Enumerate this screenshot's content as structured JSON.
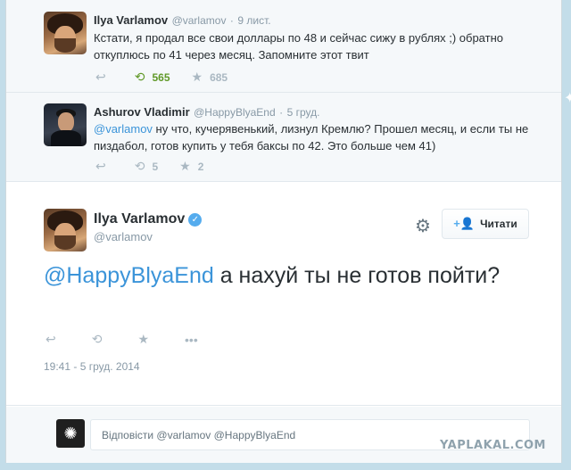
{
  "tweet1": {
    "name": "Ilya Varlamov",
    "handle": "@varlamov",
    "sep": "·",
    "date": "9 лист.",
    "text": "Кстати, я продал все свои доллары по 48 и сейчас сижу в рублях ;) обратно откуплюсь по 41 через месяц. Запомните этот твит",
    "retweets": "565",
    "favorites": "685"
  },
  "tweet2": {
    "name": "Ashurov Vladimir",
    "handle": "@HappyBlyaEnd",
    "sep": "·",
    "date": "5 груд.",
    "mention": "@varlamov",
    "text": " ну что, кучерявенький, лизнул Кремлю? Прошел месяц, и если ты не пиздабол, готов купить у тебя баксы по 42. Это больше чем 41)",
    "retweets": "5",
    "favorites": "2"
  },
  "main": {
    "name": "Ilya Varlamov",
    "handle": "@varlamov",
    "follow_label": "Читати",
    "mention": "@HappyBlyaEnd",
    "text": " а нахуй ты не готов пойти?",
    "timestamp": "19:41 - 5 груд. 2014"
  },
  "reply": {
    "prefix": "Відповісти ",
    "mentions": "@varlamov @HappyBlyaEnd"
  },
  "watermark": "YAPLAKAL.COM",
  "icons": {
    "reply": "reply-icon",
    "retweet": "retweet-icon",
    "favorite": "star-icon",
    "more": "more-icon",
    "gear": "gear-icon",
    "follow": "add-user-icon"
  },
  "colors": {
    "link": "#3b94d9",
    "retweet_active": "#609928",
    "verified": "#55acee"
  }
}
